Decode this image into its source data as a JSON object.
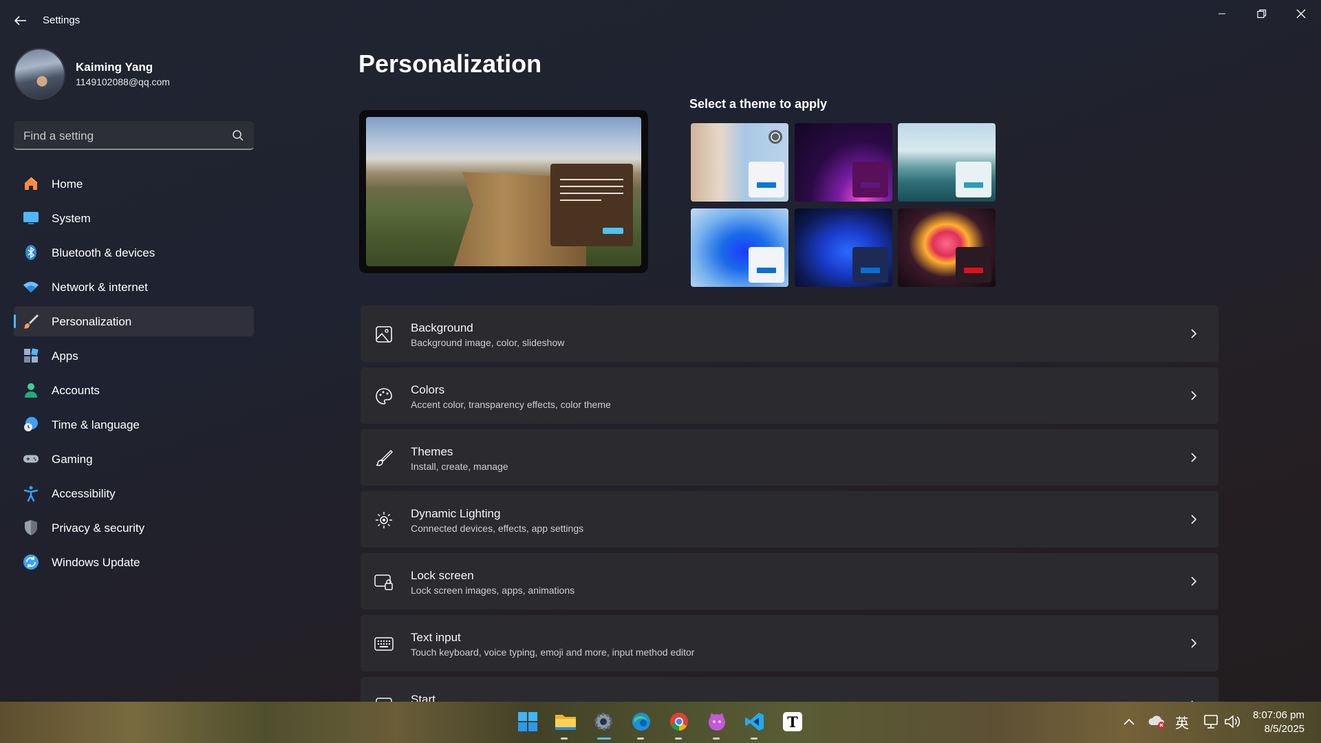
{
  "window": {
    "title": "Settings",
    "back_icon": "back-arrow-icon",
    "controls": [
      "minimize-icon",
      "maximize-icon",
      "close-icon"
    ]
  },
  "profile": {
    "name": "Kaiming Yang",
    "email": "1149102088@qq.com"
  },
  "search": {
    "placeholder": "Find a setting"
  },
  "sidebar": {
    "items": [
      {
        "label": "Home",
        "icon": "home-icon",
        "color": "#ff8a3d"
      },
      {
        "label": "System",
        "icon": "monitor-icon",
        "color": "#4fb7ff"
      },
      {
        "label": "Bluetooth & devices",
        "icon": "bluetooth-icon",
        "color": "#2b88d8"
      },
      {
        "label": "Network & internet",
        "icon": "wifi-icon",
        "color": "#6cc0ff"
      },
      {
        "label": "Personalization",
        "icon": "paintbrush-icon",
        "color": "#f0a060",
        "active": true
      },
      {
        "label": "Apps",
        "icon": "apps-icon",
        "color": "#8aa0c0"
      },
      {
        "label": "Accounts",
        "icon": "person-icon",
        "color": "#3ccf9a"
      },
      {
        "label": "Time & language",
        "icon": "globe-clock-icon",
        "color": "#4fb7ff"
      },
      {
        "label": "Gaming",
        "icon": "gamepad-icon",
        "color": "#b0b8c8"
      },
      {
        "label": "Accessibility",
        "icon": "accessibility-icon",
        "color": "#3aa0ff"
      },
      {
        "label": "Privacy & security",
        "icon": "shield-icon",
        "color": "#9aa0a8"
      },
      {
        "label": "Windows Update",
        "icon": "update-icon",
        "color": "#3aa0ff"
      }
    ]
  },
  "main": {
    "title": "Personalization",
    "themes_heading": "Select a theme to apply",
    "themes": [
      {
        "name": "theme-flowers",
        "accent": "#0a78d4",
        "mini_bg": "#f2f4f7"
      },
      {
        "name": "theme-glow",
        "accent": "#5a1a7a",
        "mini_bg": "#5a0f5a"
      },
      {
        "name": "theme-lake",
        "accent": "#2a9ec0",
        "mini_bg": "#e8f2f4"
      },
      {
        "name": "theme-bloom-light",
        "accent": "#0a6fd4",
        "mini_bg": "#f2f4f7"
      },
      {
        "name": "theme-bloom-dark",
        "accent": "#0a6fd4",
        "mini_bg": "#1c2a55"
      },
      {
        "name": "theme-captured-motion",
        "accent": "#e0101a",
        "mini_bg": "#2a1a22"
      }
    ],
    "cards": [
      {
        "title": "Background",
        "subtitle": "Background image, color, slideshow",
        "icon": "image-icon"
      },
      {
        "title": "Colors",
        "subtitle": "Accent color, transparency effects, color theme",
        "icon": "palette-icon"
      },
      {
        "title": "Themes",
        "subtitle": "Install, create, manage",
        "icon": "brush-icon"
      },
      {
        "title": "Dynamic Lighting",
        "subtitle": "Connected devices, effects, app settings",
        "icon": "lighting-icon"
      },
      {
        "title": "Lock screen",
        "subtitle": "Lock screen images, apps, animations",
        "icon": "lock-screen-icon"
      },
      {
        "title": "Text input",
        "subtitle": "Touch keyboard, voice typing, emoji and more, input method editor",
        "icon": "keyboard-icon"
      },
      {
        "title": "Start",
        "subtitle": "",
        "icon": "start-icon"
      }
    ]
  },
  "taskbar": {
    "apps": [
      {
        "name": "windows-start-icon"
      },
      {
        "name": "file-explorer-icon"
      },
      {
        "name": "settings-app-icon"
      },
      {
        "name": "edge-icon"
      },
      {
        "name": "chrome-icon"
      },
      {
        "name": "cat-app-icon"
      },
      {
        "name": "vscode-icon"
      },
      {
        "name": "typora-icon",
        "label": "T"
      }
    ],
    "tray": {
      "ime": "英",
      "time": "8:07:06 pm",
      "date": "8/5/2025"
    }
  }
}
